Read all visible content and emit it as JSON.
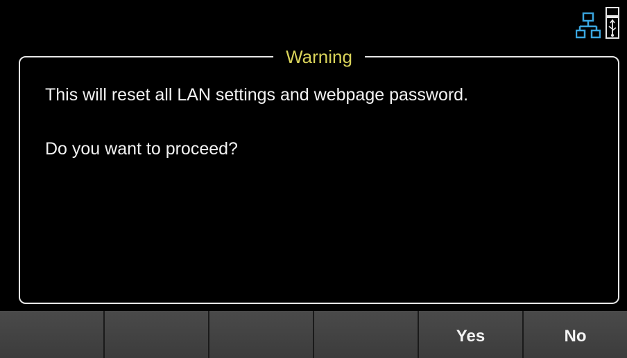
{
  "status_bar": {
    "icons": [
      "lan-icon",
      "usb-icon"
    ],
    "lan_color": "#3aa6e0",
    "usb_color": "#e8e8e8"
  },
  "dialog": {
    "title": "Warning",
    "title_color": "#d9d35a",
    "messages": [
      "This will reset all LAN settings and webpage password.",
      "Do you want to proceed?"
    ]
  },
  "softkeys": [
    {
      "label": ""
    },
    {
      "label": ""
    },
    {
      "label": ""
    },
    {
      "label": ""
    },
    {
      "label": "Yes"
    },
    {
      "label": "No"
    }
  ]
}
